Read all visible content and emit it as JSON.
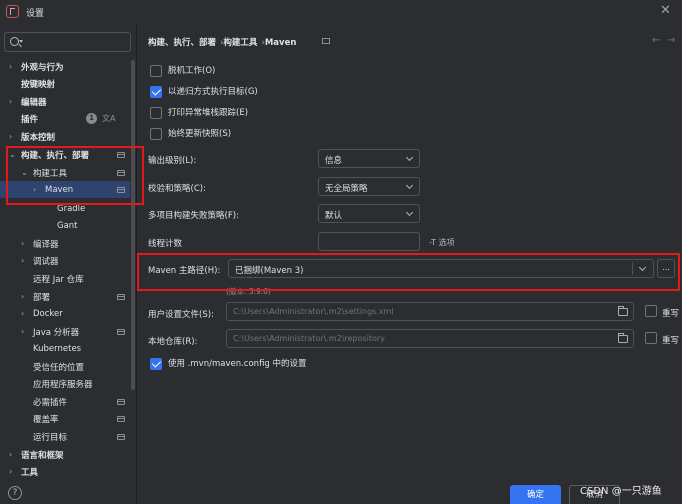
{
  "window": {
    "title": "设置"
  },
  "sidebar": {
    "search_placeholder": "",
    "items": [
      {
        "label": "外观与行为",
        "arrow": "›",
        "bold": true
      },
      {
        "label": "按键映射",
        "bold": true
      },
      {
        "label": "编辑器",
        "arrow": "›",
        "bold": true
      },
      {
        "label": "插件",
        "bold": true,
        "badge": "1"
      },
      {
        "label": "版本控制",
        "arrow": "›",
        "bold": true
      },
      {
        "label": "构建、执行、部署",
        "arrow": "⌄",
        "bold": true
      },
      {
        "label": "构建工具",
        "arrow": "⌄"
      },
      {
        "label": "Maven",
        "arrow": "›",
        "selected": true
      },
      {
        "label": "Gradle"
      },
      {
        "label": "Gant"
      },
      {
        "label": "编译器",
        "arrow": "›"
      },
      {
        "label": "调试器",
        "arrow": "›"
      },
      {
        "label": "远程 Jar 仓库"
      },
      {
        "label": "部署",
        "arrow": "›"
      },
      {
        "label": "Docker",
        "arrow": "›"
      },
      {
        "label": "Java 分析器",
        "arrow": "›"
      },
      {
        "label": "Kubernetes"
      },
      {
        "label": "受信任的位置"
      },
      {
        "label": "应用程序服务器"
      },
      {
        "label": "必需插件"
      },
      {
        "label": "覆盖率"
      },
      {
        "label": "运行目标"
      },
      {
        "label": "语言和框架",
        "arrow": "›",
        "bold": true
      },
      {
        "label": "工具",
        "arrow": "›",
        "bold": true
      }
    ]
  },
  "breadcrumb": [
    "构建、执行、部署",
    "构建工具",
    "Maven"
  ],
  "options": [
    {
      "label": "脱机工作(O)",
      "checked": false
    },
    {
      "label": "以递归方式执行目标(G)",
      "checked": true
    },
    {
      "label": "打印异常堆栈跟踪(E)",
      "checked": false
    },
    {
      "label": "始终更新快照(S)",
      "checked": false
    }
  ],
  "form": {
    "output_level": {
      "label": "输出级别(L):",
      "value": "信息"
    },
    "checksum_policy": {
      "label": "校验和策略(C):",
      "value": "无全局策略"
    },
    "multiproject_fail": {
      "label": "多项目构建失败策略(F):",
      "value": "默认"
    },
    "thread_count": {
      "label": "线程计数",
      "value": "",
      "hint": "-T 选项"
    },
    "maven_home": {
      "label": "Maven 主路径(H):",
      "value": "已捆绑(Maven 3)",
      "more": "...",
      "version": "(版本: 3.9.6)"
    },
    "user_settings": {
      "label": "用户设置文件(S):",
      "value": "C:\\Users\\Administrator\\.m2\\settings.xml",
      "override": "重写"
    },
    "local_repo": {
      "label": "本地仓库(R):",
      "value": "C:\\Users\\Administrator\\.m2\\repository",
      "override": "重写"
    },
    "use_mvn_config": {
      "label": "使用 .mvn/maven.config 中的设置",
      "checked": true
    }
  },
  "buttons": {
    "ok": "确定",
    "cancel": "取消"
  },
  "watermark": "CSDN @一只游鱼",
  "colors": {
    "accent": "#3574f0",
    "highlight_box": "#e5181c",
    "selected_row": "#2e436e"
  }
}
